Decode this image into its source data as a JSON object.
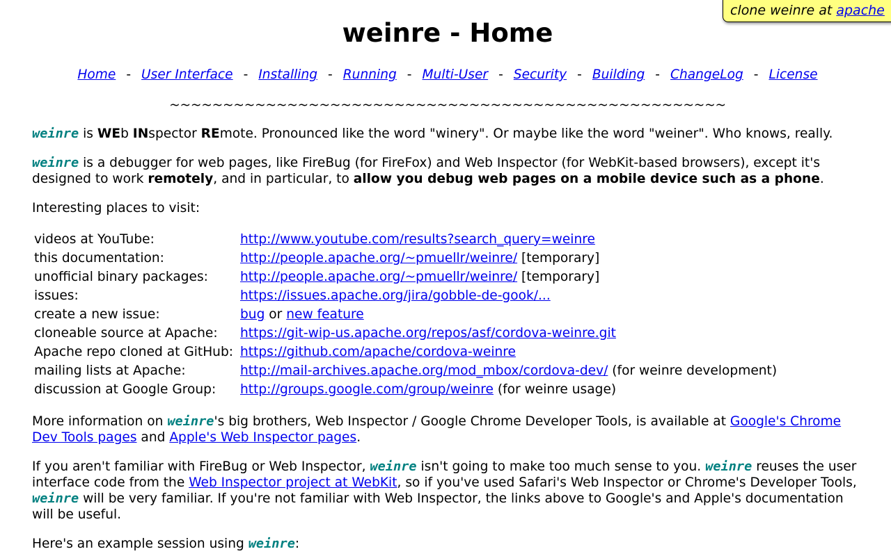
{
  "ribbon": {
    "prefix": "clone weinre at ",
    "link": "apache"
  },
  "title": "weinre - Home",
  "nav": {
    "items": [
      "Home",
      "User Interface",
      "Installing",
      "Running",
      "Multi-User",
      "Security",
      "Building",
      "ChangeLog",
      "License"
    ],
    "separator": "-"
  },
  "divider": "~~~~~~~~~~~~~~~~~~~~~~~~~~~~~~~~~~~~~~~~~~~~~~~~~~~~",
  "brand": "weinre",
  "intro": {
    "we": "WE",
    "b": "b ",
    "in": "IN",
    "spector": "spector ",
    "re": "RE",
    "rest": "mote. Pronounced like the word \"winery\". Or maybe like the word \"weiner\". Who knows, really.",
    "is": " is "
  },
  "desc": {
    "t1": " is a debugger for web pages, like FireBug (for FireFox) and Web Inspector (for WebKit-based browsers), except it's designed to work ",
    "b1": "remotely",
    "t2": ", and in particular, to ",
    "b2": "allow you debug web pages on a mobile device such as a phone",
    "t3": "."
  },
  "places_heading": "Interesting places to visit:",
  "places": [
    {
      "label": "videos at YouTube:",
      "link": "http://www.youtube.com/results?search_query=weinre",
      "suffix": ""
    },
    {
      "label": "this documentation:",
      "link": "http://people.apache.org/~pmuellr/weinre/",
      "suffix": " [temporary]"
    },
    {
      "label": "unofficial binary packages:",
      "link": "http://people.apache.org/~pmuellr/weinre/",
      "suffix": " [temporary]"
    },
    {
      "label": "issues:",
      "link": "https://issues.apache.org/jira/gobble-de-gook/...",
      "suffix": ""
    },
    {
      "label": "create a new issue:",
      "link": "bug",
      "middle": " or ",
      "link2": "new feature"
    },
    {
      "label": "cloneable source at Apache:",
      "link": "https://git-wip-us.apache.org/repos/asf/cordova-weinre.git",
      "suffix": ""
    },
    {
      "label": "Apache repo cloned at GitHub:",
      "link": "https://github.com/apache/cordova-weinre",
      "suffix": ""
    },
    {
      "label": "mailing lists at Apache:",
      "link": "http://mail-archives.apache.org/mod_mbox/cordova-dev/",
      "suffix": " (for weinre development)"
    },
    {
      "label": "discussion at Google Group:",
      "link": "http://groups.google.com/group/weinre",
      "suffix": " (for weinre usage)"
    }
  ],
  "more": {
    "t1": "More information on ",
    "t2": "'s big brothers, Web Inspector / Google Chrome Developer Tools, is available at ",
    "l1": "Google's Chrome Dev Tools pages",
    "t3": " and ",
    "l2": "Apple's Web Inspector pages",
    "t4": "."
  },
  "familiar": {
    "t1": "If you aren't familiar with FireBug or Web Inspector, ",
    "t2": " isn't going to make too much sense to you. ",
    "t3": " reuses the user interface code from the ",
    "l1": "Web Inspector project at WebKit",
    "t4": ", so if you've used Safari's Web Inspector or Chrome's Developer Tools, ",
    "t5": " will be very familiar. If you're not familiar with Web Inspector, the links above to Google's and Apple's documentation will be useful."
  },
  "example": {
    "t1": "Here's an example session using ",
    "t2": ":"
  },
  "colors": {
    "link": "#0000ee",
    "brand": "#008080",
    "ribbon_bg": "#ffff80"
  }
}
